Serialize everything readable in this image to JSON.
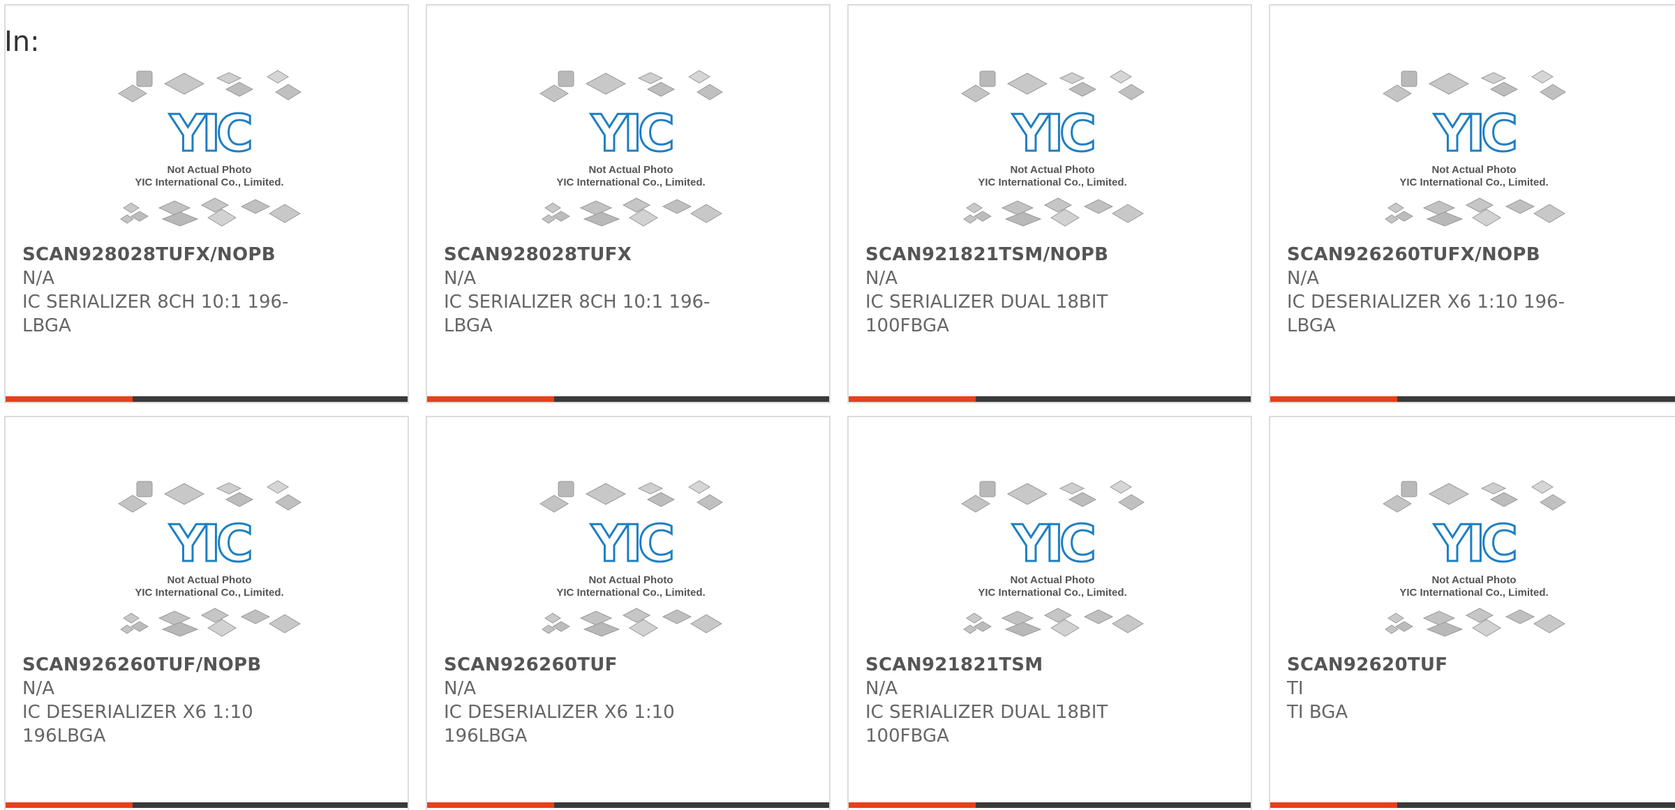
{
  "filter": {
    "label": "In:"
  },
  "watermark": {
    "logo": "YIC",
    "line1": "Not Actual Photo",
    "line2": "YIC International Co., Limited."
  },
  "colors": {
    "accent": "#e8401c",
    "bar": "#3a3a3a",
    "logo_blue": "#1e7fc2",
    "border": "#dcdcdc"
  },
  "products": [
    {
      "part_number": "SCAN928028TUFX/NOPB",
      "manufacturer": "N/A",
      "description": "IC SERIALIZER 8CH 10:1 196-LBGA"
    },
    {
      "part_number": "SCAN928028TUFX",
      "manufacturer": "N/A",
      "description": "IC SERIALIZER 8CH 10:1 196-LBGA"
    },
    {
      "part_number": "SCAN921821TSM/NOPB",
      "manufacturer": "N/A",
      "description": "IC SERIALIZER DUAL 18BIT 100FBGA"
    },
    {
      "part_number": "SCAN926260TUFX/NOPB",
      "manufacturer": "N/A",
      "description": "IC DESERIALIZER X6 1:10 196-LBGA"
    },
    {
      "part_number": "SCAN926260TUF/NOPB",
      "manufacturer": "N/A",
      "description": "IC DESERIALIZER X6 1:10 196LBGA"
    },
    {
      "part_number": "SCAN926260TUF",
      "manufacturer": "N/A",
      "description": "IC DESERIALIZER X6 1:10 196LBGA"
    },
    {
      "part_number": "SCAN921821TSM",
      "manufacturer": "N/A",
      "description": "IC SERIALIZER DUAL 18BIT 100FBGA"
    },
    {
      "part_number": "SCAN92620TUF",
      "manufacturer": "TI",
      "description": "TI BGA"
    }
  ]
}
